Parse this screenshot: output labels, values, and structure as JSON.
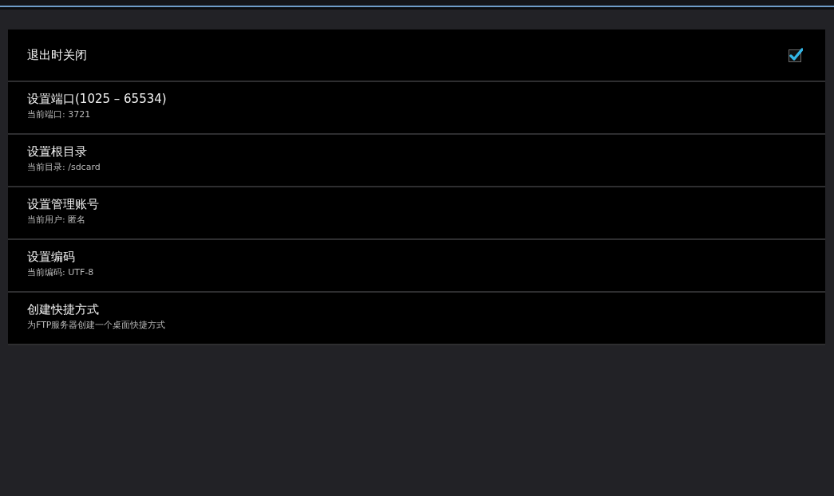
{
  "settings": [
    {
      "kind": "checkbox",
      "title": "退出时关闭",
      "checked": true
    },
    {
      "kind": "text",
      "title": "设置端口(1025 – 65534)",
      "summary": "当前端口: 3721"
    },
    {
      "kind": "text",
      "title": "设置根目录",
      "summary": "当前目录: /sdcard"
    },
    {
      "kind": "text",
      "title": "设置管理账号",
      "summary": "当前用户: 匿名"
    },
    {
      "kind": "text",
      "title": "设置编码",
      "summary": "当前编码: UTF-8"
    },
    {
      "kind": "text",
      "title": "创建快捷方式",
      "summary": "为FTP服务器创建一个桌面快捷方式"
    }
  ]
}
